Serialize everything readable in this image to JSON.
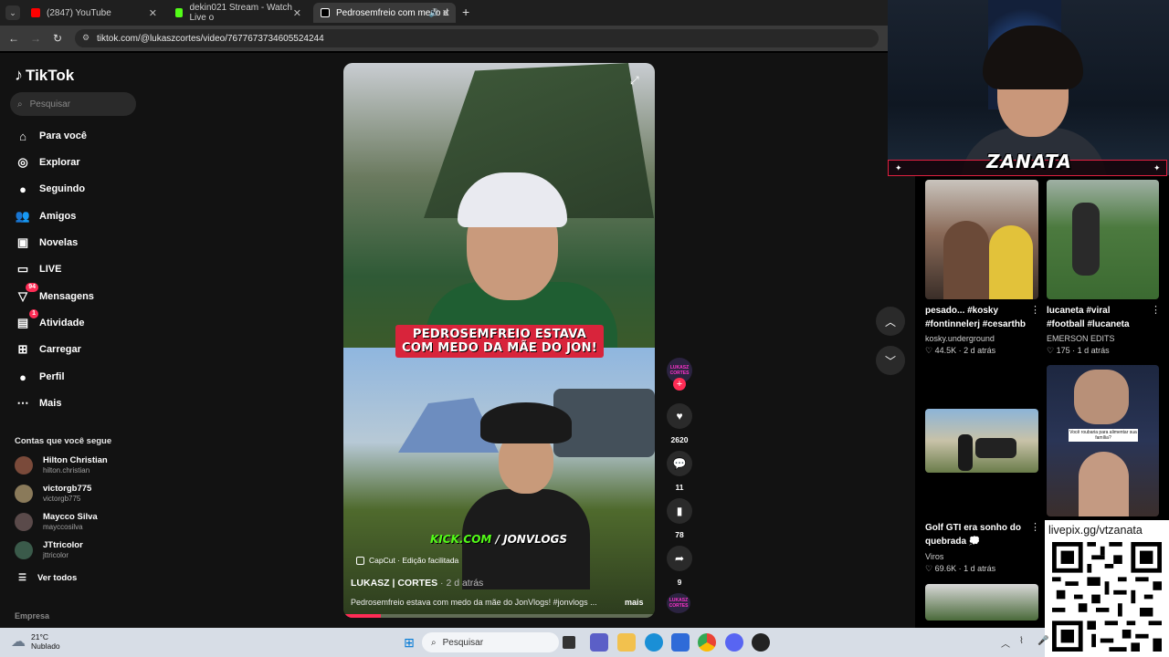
{
  "browser": {
    "tabs": [
      {
        "label": "(2847) YouTube",
        "color": "#ff0000"
      },
      {
        "label": "dekin021 Stream - Watch Live o",
        "color": "#53fc18"
      },
      {
        "label": "Pedrosemfreio com medo d",
        "color": "#ffffff"
      }
    ],
    "new_tab": "+",
    "url": "tiktok.com/@lukaszcortes/video/7677673734605524244"
  },
  "sidebar": {
    "logo": "TikTok",
    "search_placeholder": "Pesquisar",
    "nav": [
      {
        "label": "Para você",
        "icon": "home-icon",
        "glyph": "⌂"
      },
      {
        "label": "Explorar",
        "icon": "compass-icon",
        "glyph": "◎"
      },
      {
        "label": "Seguindo",
        "icon": "following-icon",
        "glyph": "●"
      },
      {
        "label": "Amigos",
        "icon": "friends-icon",
        "glyph": "👥"
      },
      {
        "label": "Novelas",
        "icon": "novelas-icon",
        "glyph": "▣"
      },
      {
        "label": "LIVE",
        "icon": "live-icon",
        "glyph": "▭"
      },
      {
        "label": "Mensagens",
        "icon": "messages-icon",
        "glyph": "▽",
        "badge": "94"
      },
      {
        "label": "Atividade",
        "icon": "activity-icon",
        "glyph": "▤",
        "badge": "1"
      },
      {
        "label": "Carregar",
        "icon": "upload-icon",
        "glyph": "⊞"
      },
      {
        "label": "Perfil",
        "icon": "profile-icon",
        "glyph": "●"
      },
      {
        "label": "Mais",
        "icon": "more-icon",
        "glyph": "⋯"
      }
    ],
    "following_title": "Contas que você segue",
    "accounts": [
      {
        "name": "Hilton Christian",
        "handle": "hilton.christian",
        "color": "#7a4a3a"
      },
      {
        "name": "victorgb775",
        "handle": "victorgb775",
        "color": "#8a7a5a"
      },
      {
        "name": "Maycco Silva",
        "handle": "mayccosilva",
        "color": "#5a4a4a"
      },
      {
        "name": "JTtricolor",
        "handle": "jttricolor",
        "color": "#3a5a4a"
      }
    ],
    "see_all": "Ver todos",
    "company": "Empresa"
  },
  "video": {
    "caption_line1": "PEDROSEMFREIO ESTAVA",
    "caption_line2": "COM MEDO DA MÃE DO JON!",
    "kick_prefix": "KICK.COM",
    "kick_suffix": "/ JONVLOGS",
    "capcut": "CapCut · Edição facilitada",
    "author": "LUKASZ | CORTES",
    "ago": " · 2 d atrás",
    "description": "Pedrosemfreio estava com medo da mãe do JonVlogs! #jonvlogs ...",
    "more": "mais",
    "progress": 0.12
  },
  "actions": {
    "avatar_label": "LUKASZ CORTES",
    "likes": "2620",
    "comments": "11",
    "saves": "78",
    "shares": "9"
  },
  "overlay": {
    "streamer_name": "ZANATA",
    "qr_url": "livepix.gg/vtzanata"
  },
  "recommendations": [
    {
      "title_line1": "pesado... #kosky",
      "title_line2": "#fontinnelerj #cesarthb",
      "author": "kosky.underground",
      "likes": "44.5K",
      "ago": "2 d atrás"
    },
    {
      "title_line1": "lucaneta #viral",
      "title_line2": "#football #lucaneta",
      "author": "EMERSON EDITS",
      "likes": "175",
      "ago": "1 d atrás"
    },
    {
      "title_line1": "Golf GTI era sonho do",
      "title_line2": "quebrada 💭",
      "author": "Viros",
      "likes": "69.6K",
      "ago": "1 d atrás"
    },
    {
      "overlay_text": "Você roubaria para alimentar sua família?"
    }
  ],
  "taskbar": {
    "temperature": "21°C",
    "weather": "Nublado",
    "search": "Pesquisar"
  }
}
